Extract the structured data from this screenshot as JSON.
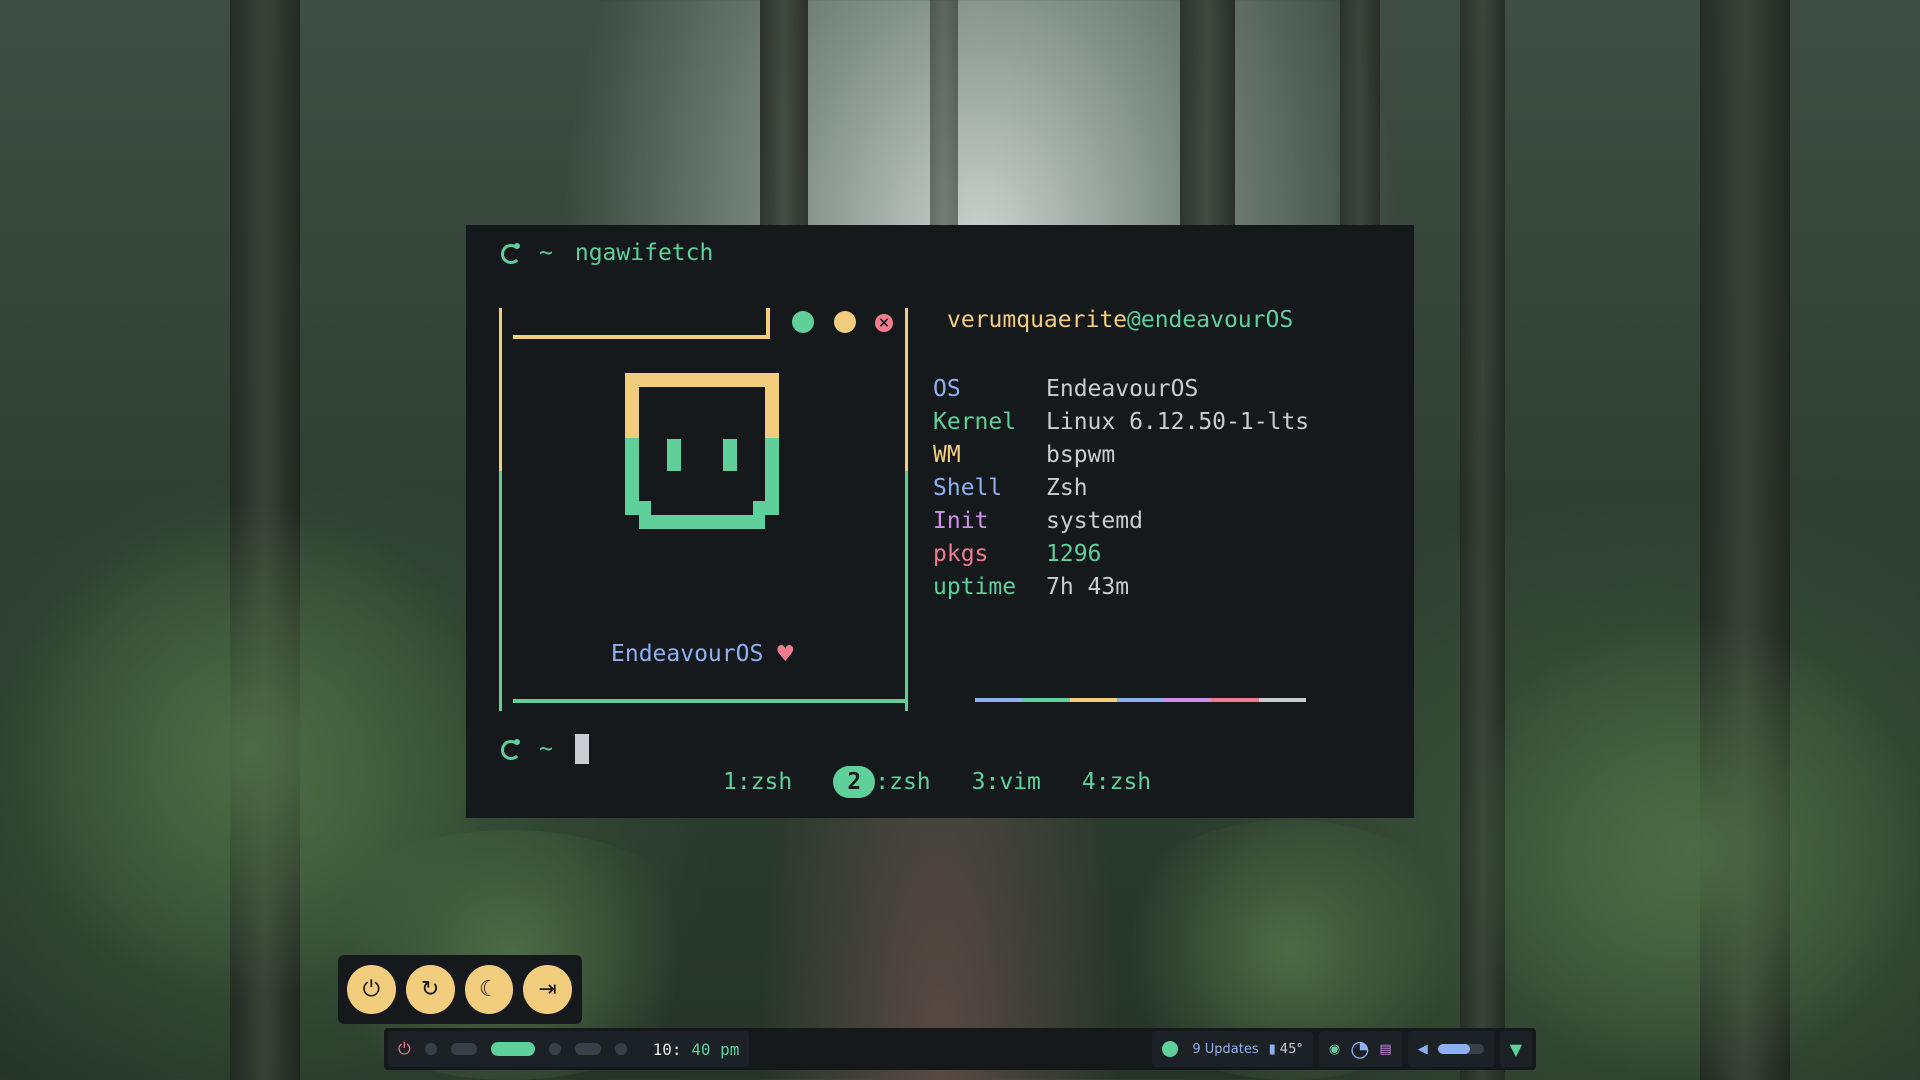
{
  "terminal": {
    "prompt_tilde": "~",
    "command": "ngawifetch",
    "user": "verumquaerite",
    "at_host": "@endeavourOS",
    "os_label": "EndeavourOS",
    "heart": "♥",
    "close_glyph": "×",
    "info": [
      {
        "key": "OS",
        "value": "EndeavourOS",
        "key_color": "#8fb0f0",
        "value_color": "#c9ccd1"
      },
      {
        "key": "Kernel",
        "value": "Linux 6.12.50-1-lts",
        "key_color": "#5fd09a",
        "value_color": "#c9ccd1"
      },
      {
        "key": "WM",
        "value": "bspwm",
        "key_color": "#f3cd7e",
        "value_color": "#c9ccd1"
      },
      {
        "key": "Shell",
        "value": "Zsh",
        "key_color": "#8fb0f0",
        "value_color": "#c9ccd1"
      },
      {
        "key": "Init",
        "value": "systemd",
        "key_color": "#d08fe8",
        "value_color": "#c9ccd1"
      },
      {
        "key": "pkgs",
        "value": "1296",
        "key_color": "#f07a8e",
        "value_color": "#5fd09a"
      },
      {
        "key": "uptime",
        "value": "7h 43m",
        "key_color": "#5fd09a",
        "value_color": "#c9ccd1"
      }
    ],
    "colorbar": [
      "#8fb0f0",
      "#5fd09a",
      "#f3cd7e",
      "#8fb0f0",
      "#d08fe8",
      "#f07a8e",
      "#c9ccd1"
    ],
    "tabs": [
      {
        "num": "1",
        "label": ":zsh",
        "active": false
      },
      {
        "num": "2",
        "label": ":zsh",
        "active": true
      },
      {
        "num": "3",
        "label": ":vim",
        "active": false
      },
      {
        "num": "4",
        "label": ":zsh",
        "active": false
      }
    ]
  },
  "power_menu": {
    "buttons": [
      {
        "name": "shutdown-button",
        "icon": "power-icon",
        "glyph": "⏻"
      },
      {
        "name": "reboot-button",
        "icon": "restart-icon",
        "glyph": "↻"
      },
      {
        "name": "sleep-button",
        "icon": "moon-icon",
        "glyph": "☾"
      },
      {
        "name": "logout-button",
        "icon": "logout-icon",
        "glyph": "⇥"
      }
    ]
  },
  "bar": {
    "power_glyph": "⏻",
    "clock_hour": "10:",
    "clock_rest": " 40 pm",
    "updates": "9 Updates",
    "temp": "45°",
    "volume_level": 0.7
  },
  "colors": {
    "accent_green": "#5fd09a",
    "accent_yellow": "#f3cd7e",
    "accent_blue": "#8fb0f0",
    "accent_pink": "#f07a8e",
    "background": "#15191c"
  }
}
